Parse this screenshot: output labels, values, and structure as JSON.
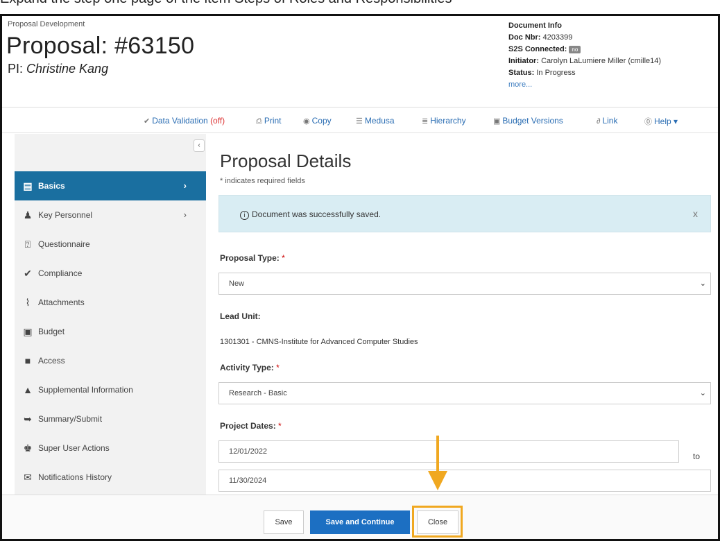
{
  "caption": "Expand the step one page of the item Steps of Roles and Responsibilities",
  "header": {
    "breadcrumb": "Proposal Development",
    "title": "Proposal: #63150",
    "pi_label": "PI: ",
    "pi_name": "Christine Kang"
  },
  "doc_info": {
    "heading": "Document Info",
    "doc_nbr_label": "Doc Nbr:",
    "doc_nbr": "4203399",
    "s2s_label": "S2S Connected:",
    "s2s_value": "no",
    "initiator_label": "Initiator:",
    "initiator": "Carolyn LaLumiere Miller (cmille14)",
    "status_label": "Status:",
    "status": "In Progress",
    "more": "more..."
  },
  "toolbar": {
    "data_validation": "Data Validation",
    "data_validation_state": "(off)",
    "print": "Print",
    "copy": "Copy",
    "medusa": "Medusa",
    "hierarchy": "Hierarchy",
    "budget_versions": "Budget Versions",
    "link": "Link",
    "help": "Help"
  },
  "sidebar": {
    "items": [
      {
        "label": "Basics",
        "icon": "document-icon"
      },
      {
        "label": "Key Personnel",
        "icon": "person-icon"
      },
      {
        "label": "Questionnaire",
        "icon": "question-icon"
      },
      {
        "label": "Compliance",
        "icon": "check-icon"
      },
      {
        "label": "Attachments",
        "icon": "paperclip-icon"
      },
      {
        "label": "Budget",
        "icon": "money-icon"
      },
      {
        "label": "Access",
        "icon": "lock-icon"
      },
      {
        "label": "Supplemental Information",
        "icon": "bell-icon"
      },
      {
        "label": "Summary/Submit",
        "icon": "submit-icon"
      },
      {
        "label": "Super User Actions",
        "icon": "user-admin-icon"
      },
      {
        "label": "Notifications History",
        "icon": "envelope-icon"
      }
    ]
  },
  "main": {
    "title": "Proposal Details",
    "required_note": "* indicates required fields",
    "alert": "Document was successfully saved.",
    "proposal_type_label": "Proposal Type:",
    "proposal_type_value": "New",
    "lead_unit_label": "Lead Unit:",
    "lead_unit_value": "1301301 - CMNS-Institute for Advanced Computer Studies",
    "activity_type_label": "Activity Type:",
    "activity_type_value": "Research - Basic",
    "project_dates_label": "Project Dates:",
    "start_date": "12/01/2022",
    "to_label": "to",
    "end_date": "11/30/2024"
  },
  "footer": {
    "save": "Save",
    "save_continue": "Save and Continue",
    "close": "Close"
  },
  "colors": {
    "accent": "#1a6fa0",
    "primary_button": "#1c6fc2",
    "highlight": "#f0a820",
    "alert_bg": "#d9edf3"
  }
}
